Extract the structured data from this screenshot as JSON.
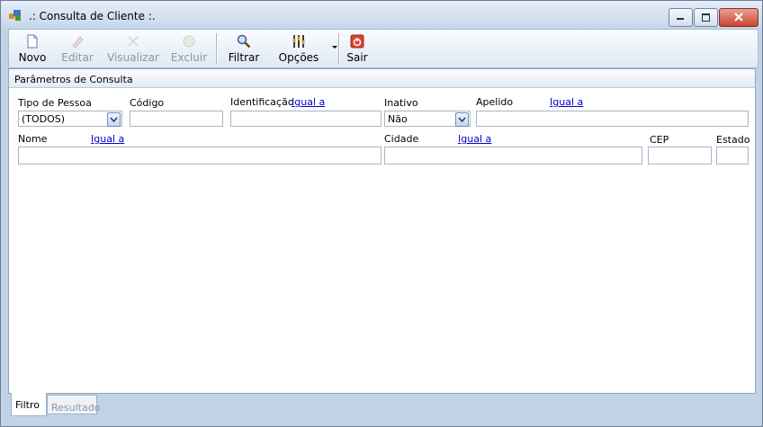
{
  "window": {
    "title": ".: Consulta de Cliente :."
  },
  "toolbar": {
    "novo": "Novo",
    "editar": "Editar",
    "visualizar": "Visualizar",
    "excluir": "Excluir",
    "filtrar": "Filtrar",
    "opcoes": "Opções",
    "sair": "Sair"
  },
  "panel": {
    "title": "Parâmetros de Consulta"
  },
  "form": {
    "tipo_pessoa_label": "Tipo de Pessoa",
    "tipo_pessoa_value": "(TODOS)",
    "codigo_label": "Código",
    "identificacao_label": "Identificação",
    "identificacao_link": "Igual a",
    "inativo_label": "Inativo",
    "inativo_value": "Não",
    "apelido_label": "Apelido",
    "apelido_link": "Igual a",
    "nome_label": "Nome",
    "nome_link": "Igual a",
    "cidade_label": "Cidade",
    "cidade_link": "Igual a",
    "cep_label": "CEP",
    "estado_label": "Estado"
  },
  "tabs": {
    "filtro": "Filtro",
    "resultado": "Resultado"
  }
}
